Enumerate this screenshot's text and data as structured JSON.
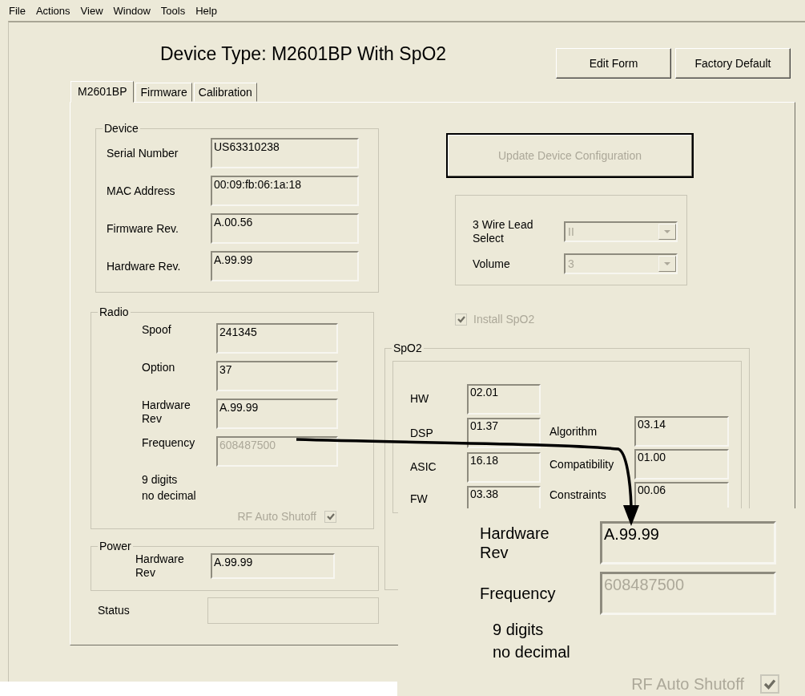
{
  "menu": [
    "File",
    "Actions",
    "View",
    "Window",
    "Tools",
    "Help"
  ],
  "title": "Device Type: M2601BP With SpO2",
  "header_buttons": [
    "Edit Form",
    "Factory Default"
  ],
  "tabs": [
    {
      "label": "M2601BP",
      "selected": true
    },
    {
      "label": "Firmware",
      "selected": false
    },
    {
      "label": "Calibration",
      "selected": false
    }
  ],
  "device": {
    "title": "Device",
    "fields": [
      {
        "label": "Serial Number",
        "value": "US63310238",
        "disabled": false
      },
      {
        "label": "MAC Address",
        "value": "00:09:fb:06:1a:18",
        "disabled": false
      },
      {
        "label": "Firmware Rev.",
        "value": "A.00.56",
        "disabled": false
      },
      {
        "label": "Hardware Rev.",
        "value": "A.99.99",
        "disabled": false
      }
    ]
  },
  "radio": {
    "title": "Radio",
    "fields": [
      {
        "label": "Spoof",
        "value": "241345",
        "disabled": false
      },
      {
        "label": "Option",
        "value": "37",
        "disabled": false
      },
      {
        "label": "Hardware Rev",
        "value": "A.99.99",
        "disabled": false
      },
      {
        "label": "Frequency",
        "value": "608487500",
        "disabled": true
      }
    ],
    "note": [
      "9 digits",
      "no decimal"
    ],
    "rf_auto_shutoff": {
      "label": "RF Auto Shutoff",
      "checked": true,
      "disabled": true
    }
  },
  "power": {
    "title": "Power",
    "fields": [
      {
        "label": "Hardware Rev",
        "value": "A.99.99",
        "disabled": false
      }
    ]
  },
  "status": {
    "label": "Status"
  },
  "update_button": {
    "label": "Update Device Configuration",
    "disabled": true
  },
  "lead_settings": [
    {
      "label": "3 Wire Lead Select",
      "value": "II",
      "disabled": true
    },
    {
      "label": "Volume",
      "value": "3",
      "disabled": true
    }
  ],
  "install_spo2": {
    "label": "Install SpO2",
    "checked": true,
    "disabled": true
  },
  "spo2": {
    "title": "SpO2",
    "left_fields": [
      {
        "label": "HW",
        "value": "02.01"
      },
      {
        "label": "DSP",
        "value": "01.37"
      },
      {
        "label": "ASIC",
        "value": "16.18"
      },
      {
        "label": "FW",
        "value": "03.38"
      }
    ],
    "right_fields": [
      {
        "label": "Algorithm",
        "value": "03.14"
      },
      {
        "label": "Compatibility",
        "value": "01.00"
      },
      {
        "label": "Constraints",
        "value": "00.06"
      }
    ]
  },
  "inset": {
    "fields": [
      {
        "label": "Hardware Rev",
        "value": "A.99.99",
        "disabled": false
      },
      {
        "label": "Frequency",
        "value": "608487500",
        "disabled": true
      }
    ],
    "note": [
      "9 digits",
      "no decimal"
    ],
    "rf_auto_shutoff": {
      "label": "RF Auto Shutoff",
      "checked": true,
      "disabled": true
    }
  }
}
